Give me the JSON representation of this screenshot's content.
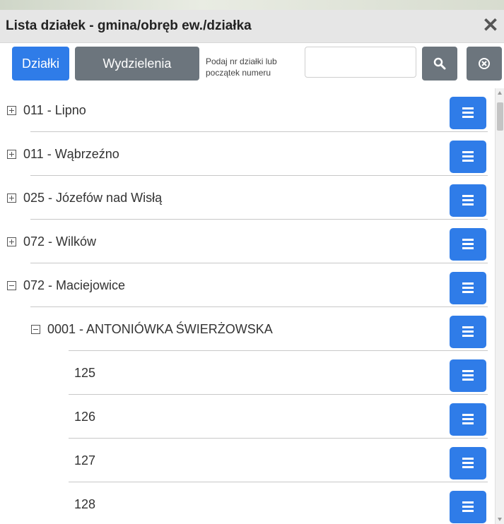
{
  "panel": {
    "title": "Lista działek - gmina/obręb ew./działka",
    "close_label": "✕"
  },
  "toolbar": {
    "tab_dzialki": "Działki",
    "tab_wydzielenia": "Wydzielenia",
    "search_hint": "Podaj nr działki lub początek numeru",
    "search_value": "",
    "search_placeholder": ""
  },
  "colors": {
    "accent": "#2f7ce8",
    "secondary": "#6c757d",
    "header_bg": "#e6e6e6"
  },
  "icons": {
    "search": "search-icon",
    "clear": "clear-circle-icon",
    "menu": "hamburger-menu-icon",
    "expand": "plus-square-icon",
    "collapse": "minus-square-icon"
  },
  "list": {
    "items": [
      {
        "label": "011 - Lipno",
        "level": 0,
        "toggle": "plus"
      },
      {
        "label": "011 - Wąbrzeźno",
        "level": 0,
        "toggle": "plus"
      },
      {
        "label": "025 - Józefów nad Wisłą",
        "level": 0,
        "toggle": "plus"
      },
      {
        "label": "072 - Wilków",
        "level": 0,
        "toggle": "plus"
      },
      {
        "label": "072 - Maciejowice",
        "level": 0,
        "toggle": "minus"
      },
      {
        "label": "0001 - ANTONIÓWKA ŚWIERŻOWSKA",
        "level": 1,
        "toggle": "minus"
      },
      {
        "label": "125",
        "level": 2,
        "toggle": "none"
      },
      {
        "label": "126",
        "level": 2,
        "toggle": "none"
      },
      {
        "label": "127",
        "level": 2,
        "toggle": "none"
      },
      {
        "label": "128",
        "level": 2,
        "toggle": "none"
      }
    ]
  }
}
